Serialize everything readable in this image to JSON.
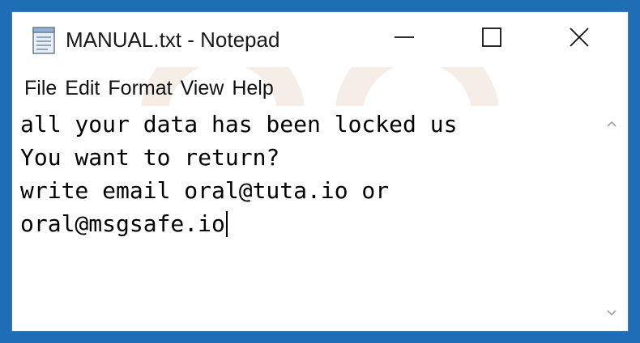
{
  "window": {
    "title": "MANUAL.txt - Notepad"
  },
  "menu": {
    "items": [
      {
        "label": "File"
      },
      {
        "label": "Edit"
      },
      {
        "label": "Format"
      },
      {
        "label": "View"
      },
      {
        "label": "Help"
      }
    ]
  },
  "editor": {
    "lines": [
      "all your data has been locked us",
      "You want to return?",
      "write email oral@tuta.io or",
      "oral@msgsafe.io"
    ]
  },
  "icons": {
    "app": "notepad-icon",
    "minimize": "minimize-icon",
    "maximize": "maximize-icon",
    "close": "close-icon",
    "scroll_up": "chevron-up-icon",
    "scroll_down": "chevron-down-icon"
  },
  "colors": {
    "frame": "#1f6db5",
    "text": "#000000",
    "background": "#ffffff"
  }
}
